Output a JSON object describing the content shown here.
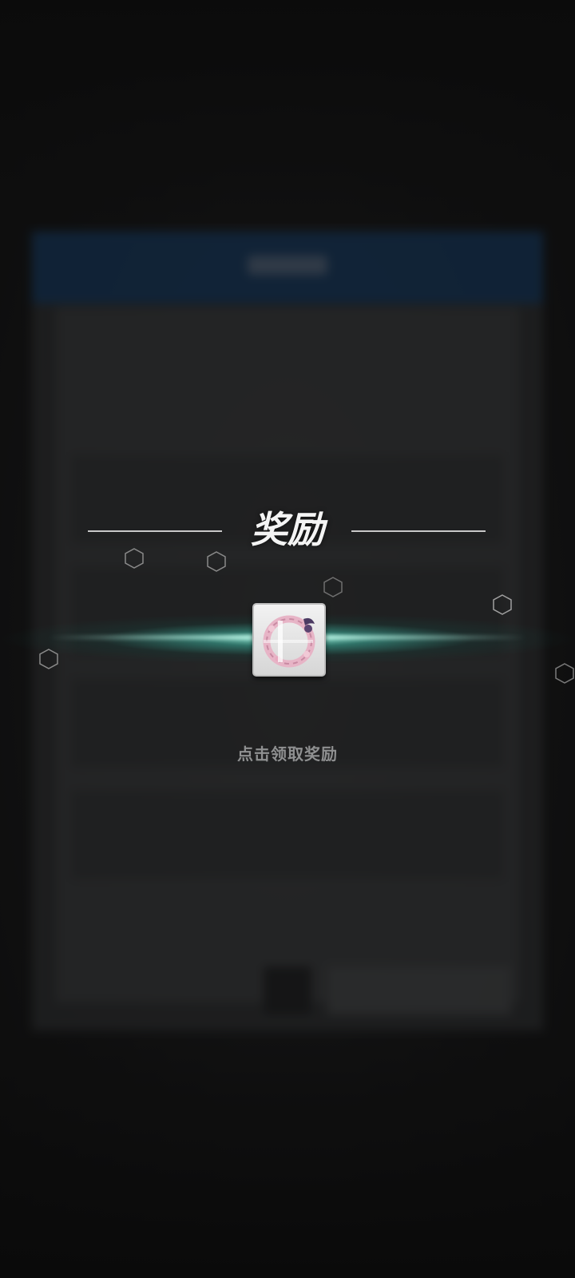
{
  "overlay": {
    "title": "奖励",
    "hint": "点击领取奖励"
  },
  "reward": {
    "icon": "pink-ring-accessory-icon"
  },
  "colors": {
    "glow": "#8ff5dc",
    "title_text": "#f4f4f4",
    "hint_text": "#8f9091",
    "backdrop_header": "#1b4a7d"
  }
}
